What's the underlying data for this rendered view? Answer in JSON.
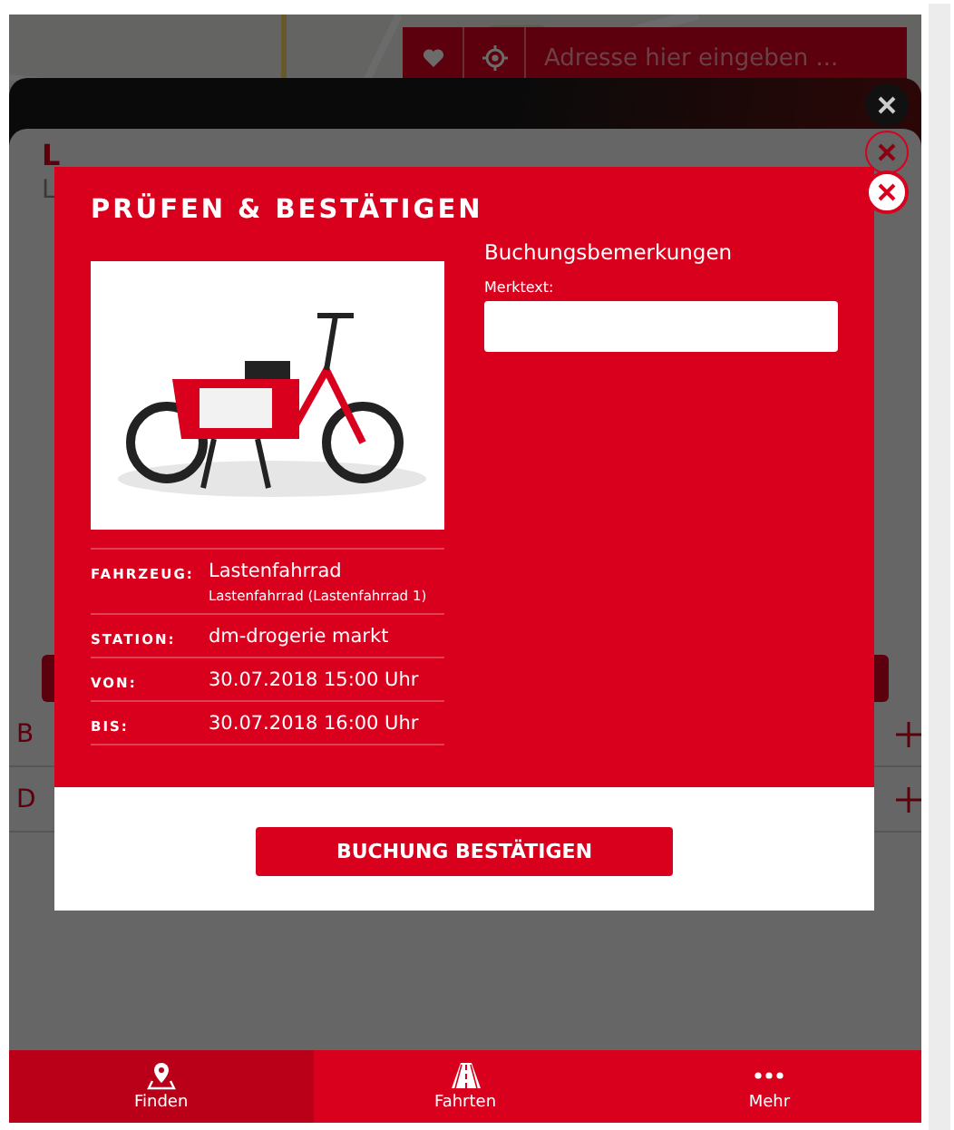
{
  "search": {
    "placeholder": "Adresse hier eingeben ..."
  },
  "background_panel": {
    "title": "L",
    "subtitle": "L",
    "rows": [
      {
        "label": "B"
      },
      {
        "label": "D"
      }
    ]
  },
  "dialog": {
    "title": "PRÜFEN & BESTÄTIGEN",
    "remarks": {
      "heading": "Buchungsbemerkungen",
      "label": "Merktext:"
    },
    "details": [
      {
        "label": "FAHRZEUG:",
        "value": "Lastenfahrrad",
        "sub": "Lastenfahrrad (Lastenfahrrad 1)"
      },
      {
        "label": "STATION:",
        "value": "dm-drogerie markt"
      },
      {
        "label": "VON:",
        "value": "30.07.2018 15:00 Uhr"
      },
      {
        "label": "BIS:",
        "value": "30.07.2018 16:00 Uhr"
      }
    ],
    "confirm": "BUCHUNG BESTÄTIGEN"
  },
  "nav": [
    {
      "label": "Finden",
      "kind": "pin",
      "selected": true
    },
    {
      "label": "Fahrten",
      "kind": "road",
      "selected": false
    },
    {
      "label": "Mehr",
      "kind": "dots",
      "selected": false
    }
  ]
}
